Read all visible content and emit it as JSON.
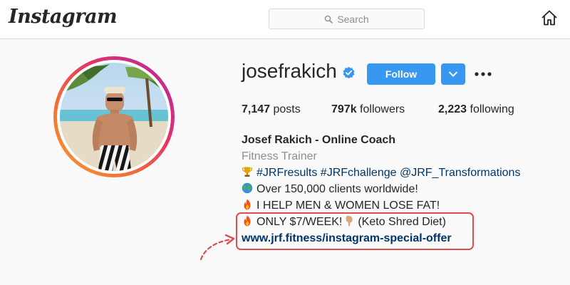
{
  "header": {
    "logo": "Instagram",
    "search_placeholder": "Search",
    "icons": [
      "search-icon",
      "home-icon"
    ]
  },
  "profile": {
    "username": "josefrakich",
    "verified": true,
    "follow_label": "Follow",
    "stats": {
      "posts_value": "7,147",
      "posts_label": "posts",
      "followers_value": "797k",
      "followers_label": "followers",
      "following_value": "2,223",
      "following_label": "following"
    },
    "bio": {
      "name": "Josef Rakich - Online Coach",
      "category": "Fitness Trainer",
      "line1_tags": "#JRFresults #JRFchallenge @JRF_Transformations",
      "line2": "Over 150,000 clients worldwide!",
      "line3": "I HELP MEN & WOMEN LOSE FAT!",
      "line4_a": "ONLY $7/WEEK!",
      "line4_b": "(Keto Shred Diet)",
      "link": "www.jrf.fitness/instagram-special-offer"
    }
  },
  "colors": {
    "follow_blue": "#3897f0",
    "verified_blue": "#3897f0",
    "highlight_red": "#e04b4b",
    "tag_navy": "#003569"
  }
}
